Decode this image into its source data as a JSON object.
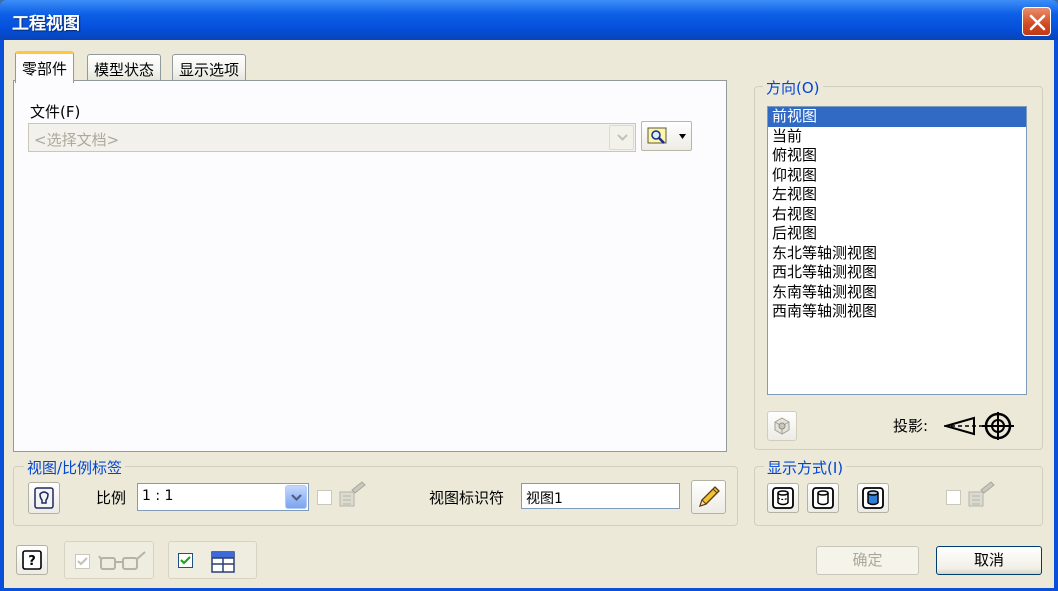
{
  "window": {
    "title": "工程视图"
  },
  "tabs": [
    {
      "label": "零部件",
      "active": true
    },
    {
      "label": "模型状态",
      "active": false
    },
    {
      "label": "显示选项",
      "active": false
    }
  ],
  "file": {
    "label": "文件(F)",
    "placeholder": "<选择文档>"
  },
  "orientation": {
    "legend": "方向(O)",
    "items": [
      "前视图",
      "当前",
      "俯视图",
      "仰视图",
      "左视图",
      "右视图",
      "后视图",
      "东北等轴测视图",
      "西北等轴测视图",
      "东南等轴测视图",
      "西南等轴测视图"
    ],
    "selected": "前视图",
    "projection_label": "投影:"
  },
  "view_scale": {
    "legend": "视图/比例标签",
    "scale_label": "比例",
    "scale_value": "1 : 1",
    "identifier_label": "视图标识符",
    "identifier_value": "视图1"
  },
  "display_style": {
    "legend": "显示方式(I)"
  },
  "buttons": {
    "ok": "确定",
    "cancel": "取消"
  },
  "colors": {
    "titlebar": "#0650dc",
    "selection": "#316ac5",
    "group_legend": "#0046d5"
  }
}
